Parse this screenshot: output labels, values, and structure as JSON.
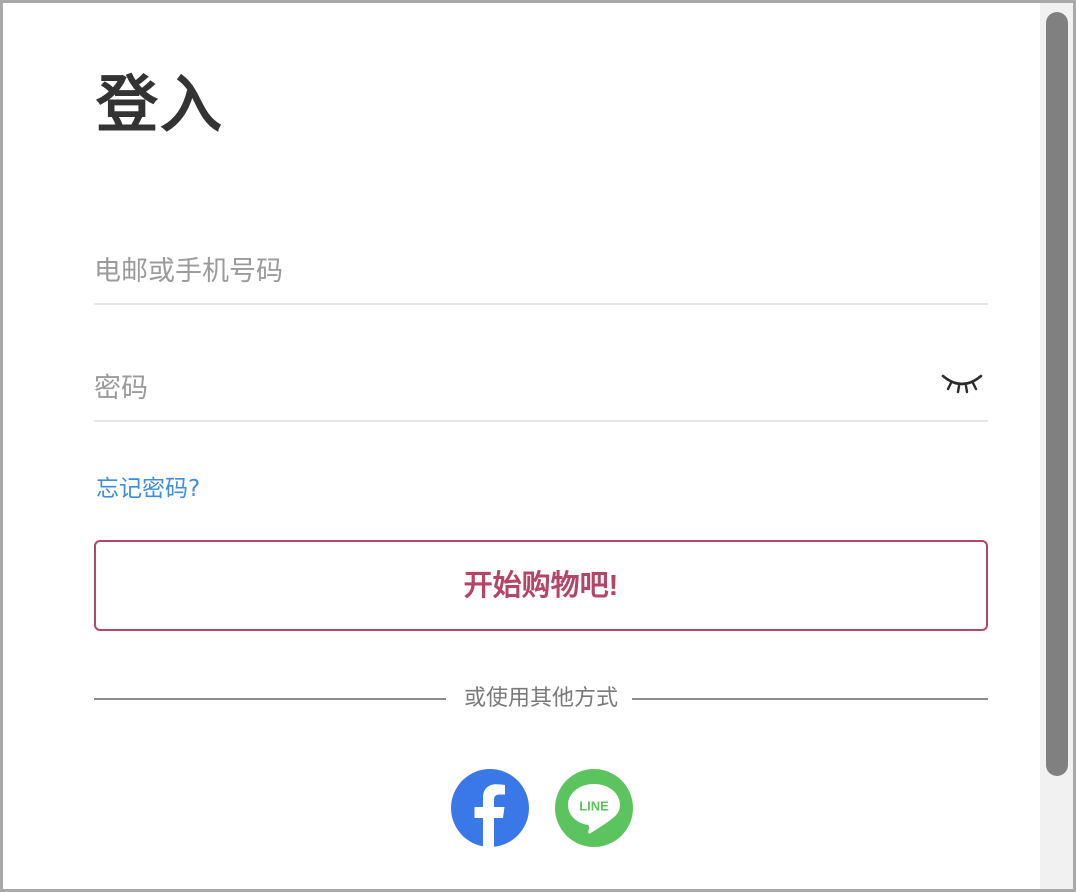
{
  "page": {
    "title": "登入"
  },
  "form": {
    "email_placeholder": "电邮或手机号码",
    "password_placeholder": "密码",
    "forgot_label": "忘记密码?",
    "submit_label": "开始购物吧!",
    "divider_label": "或使用其他方式"
  },
  "social": {
    "facebook_icon": "facebook-icon",
    "line_icon": "line-icon",
    "line_text": "LINE",
    "facebook_color": "#3b78e7",
    "line_color": "#5cc45e"
  },
  "colors": {
    "accent": "#b54565",
    "link": "#3d8ee0",
    "title": "#333333"
  }
}
